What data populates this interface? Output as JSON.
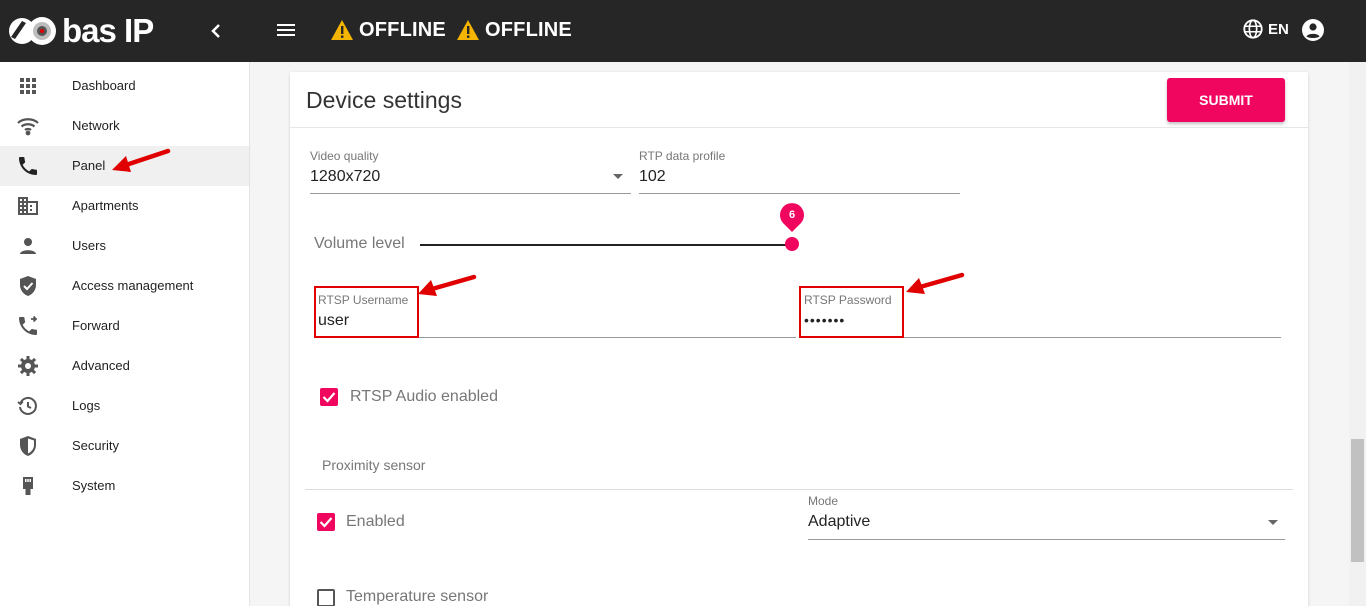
{
  "brand": {
    "logo_text": "bas IP"
  },
  "topbar": {
    "status": [
      {
        "icon": "warning-icon",
        "label": "OFFLINE"
      },
      {
        "icon": "warning-icon",
        "label": "OFFLINE"
      }
    ],
    "language": "EN"
  },
  "sidebar": {
    "items": [
      {
        "label": "Dashboard",
        "icon": "grid-icon"
      },
      {
        "label": "Network",
        "icon": "wifi-icon"
      },
      {
        "label": "Panel",
        "icon": "phone-icon",
        "active": true
      },
      {
        "label": "Apartments",
        "icon": "building-icon"
      },
      {
        "label": "Users",
        "icon": "person-icon"
      },
      {
        "label": "Access management",
        "icon": "verified-shield-icon"
      },
      {
        "label": "Forward",
        "icon": "phone-forward-icon"
      },
      {
        "label": "Advanced",
        "icon": "gear-icon"
      },
      {
        "label": "Logs",
        "icon": "history-icon"
      },
      {
        "label": "Security",
        "icon": "shield-icon"
      },
      {
        "label": "System",
        "icon": "ethernet-icon"
      }
    ]
  },
  "page": {
    "title": "Device settings",
    "submit_label": "SUBMIT",
    "video_quality": {
      "label": "Video quality",
      "value": "1280x720"
    },
    "rtp_profile": {
      "label": "RTP data profile",
      "value": "102"
    },
    "volume": {
      "label": "Volume level",
      "value": "6"
    },
    "rtsp_username": {
      "label": "RTSP Username",
      "value": "user"
    },
    "rtsp_password": {
      "label": "RTSP Password",
      "value": "•••••••"
    },
    "rtsp_audio": {
      "label": "RTSP Audio enabled",
      "checked": true
    },
    "proximity": {
      "section_label": "Proximity sensor",
      "enabled_label": "Enabled",
      "enabled_checked": true,
      "mode": {
        "label": "Mode",
        "value": "Adaptive"
      }
    },
    "temperature": {
      "label": "Temperature sensor",
      "checked": false
    }
  },
  "colors": {
    "accent": "#f0065e",
    "topbar": "#262626",
    "annotation": "#e00000",
    "warning": "#f5b400"
  }
}
